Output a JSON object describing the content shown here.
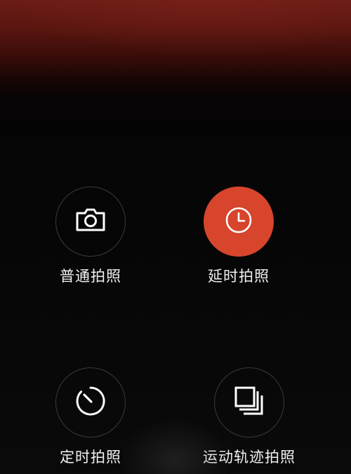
{
  "modes": [
    {
      "label": "普通拍照",
      "icon": "camera-icon",
      "active": false
    },
    {
      "label": "延时拍照",
      "icon": "clock-icon",
      "active": true
    },
    {
      "label": "定时拍照",
      "icon": "timer-icon",
      "active": false
    },
    {
      "label": "运动轨迹拍照",
      "icon": "stacked-layers-icon",
      "active": false
    }
  ],
  "colors": {
    "accent": "#d6452c",
    "background": "#050505",
    "top_tint": "#6a1c15",
    "label": "#f2f2f2",
    "ring": "#3a3a3a"
  }
}
